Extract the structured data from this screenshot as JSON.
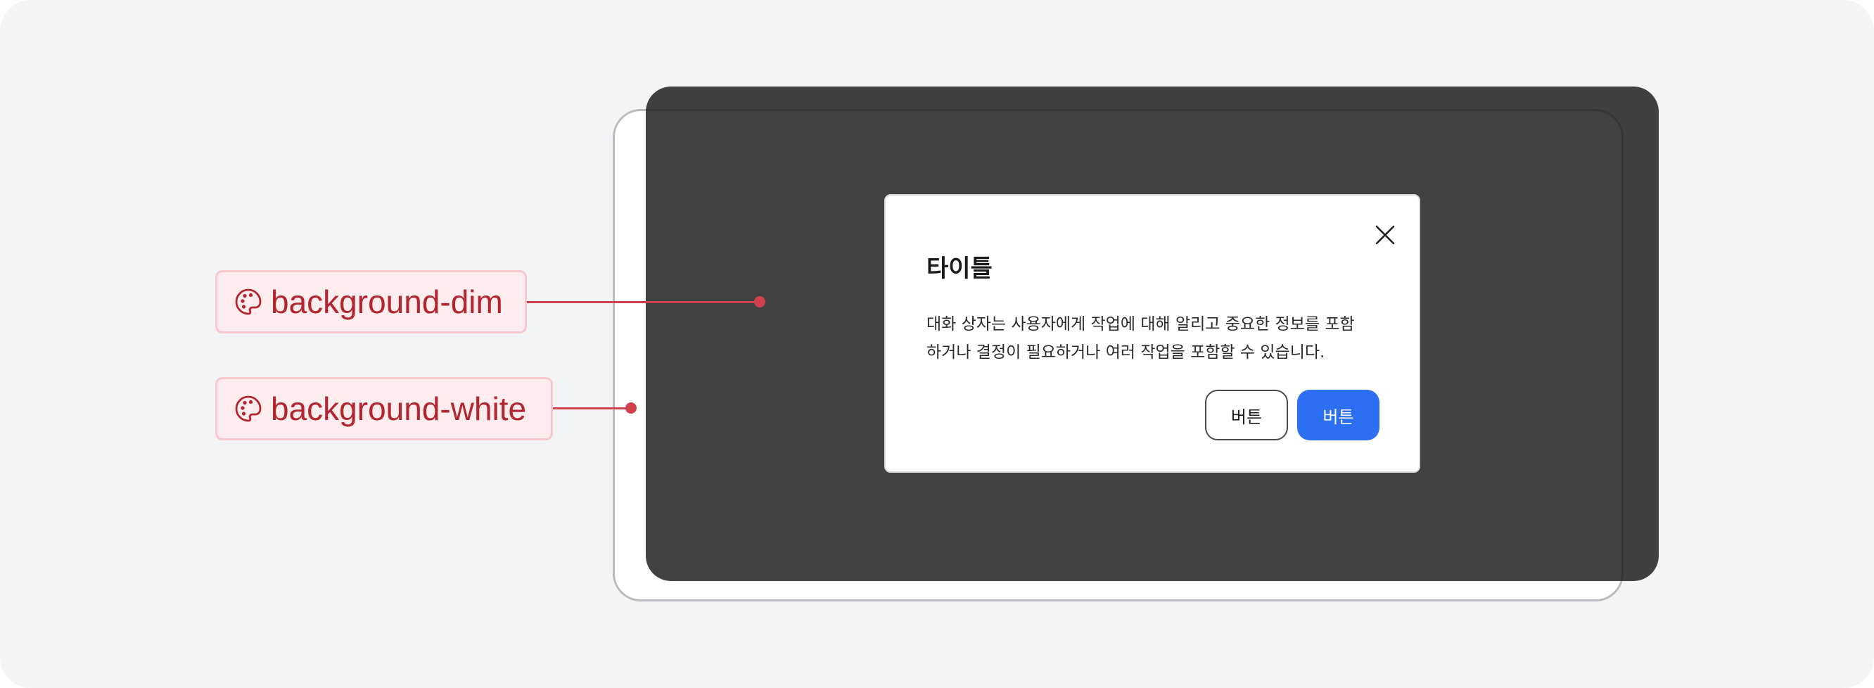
{
  "dialog": {
    "title": "타이틀",
    "body_line1": "대화 상자는 사용자에게 작업에 대해 알리고 중요한 정보를 포함",
    "body_line2": "하거나 결정이 필요하거나 여러 작업을 포함할 수 있습니다.",
    "secondary_button": "버튼",
    "primary_button": "버튼",
    "close_icon": "close-icon"
  },
  "annotations": {
    "dim": {
      "label": "background-dim",
      "icon": "palette-icon"
    },
    "white": {
      "label": "background-white",
      "icon": "palette-icon"
    }
  },
  "colors": {
    "canvas": "#f3f4f6",
    "dim_overlay": "#3f3f3f",
    "annotation_text": "#b3252f",
    "annotation_fill": "#fdeced",
    "leader_line": "#d0414b",
    "primary_button": "#2c6ff2"
  }
}
